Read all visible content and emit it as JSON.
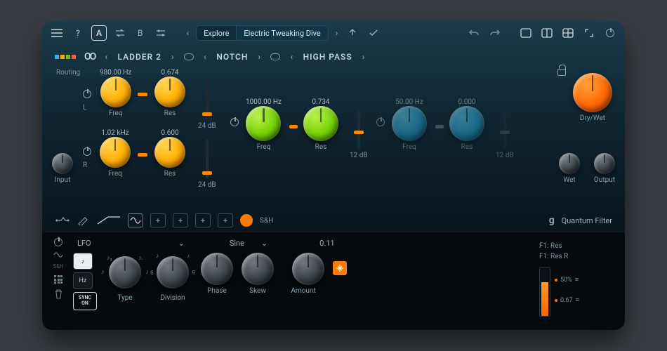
{
  "toolbar": {
    "ab_a": "A",
    "ab_b": "B",
    "explore": "Explore",
    "preset": "Electric Tweaking Dive"
  },
  "filters": {
    "routing_label": "Routing",
    "tab1": "LADDER 2",
    "tab2": "NOTCH",
    "tab3": "HIGH PASS"
  },
  "f1": {
    "freqL_val": "980.00 Hz",
    "resL_val": "0.674",
    "freqR_val": "1.02 kHz",
    "resR_val": "0.600",
    "slopeL": "24 dB",
    "slopeR": "24 dB",
    "chL": "L",
    "chR": "R",
    "freq_label": "Freq",
    "res_label": "Res"
  },
  "f2": {
    "freq_val": "1000.00 Hz",
    "res_val": "0.734",
    "slope": "12 dB",
    "freq_label": "Freq",
    "res_label": "Res"
  },
  "f3": {
    "freq_val": "50.00 Hz",
    "res_val": "0.000",
    "slope": "12 dB",
    "freq_label": "Freq",
    "res_label": "Res"
  },
  "io": {
    "input": "Input",
    "drywet": "Dry/Wet",
    "wet": "Wet",
    "output": "Output"
  },
  "mod": {
    "sh": "S&H"
  },
  "brand": "Quantum Filter",
  "lfo": {
    "title": "LFO",
    "hz": "Hz",
    "note": "♪",
    "sync1": "SYNC",
    "sync2": "ON",
    "wave": "Sine",
    "amount_val": "0.11",
    "type": "Type",
    "division": "Division",
    "phase": "Phase",
    "skew": "Skew",
    "amount": "Amount",
    "target1": "F1: Res",
    "target2": "F1: Res R",
    "m50": "50%",
    "m067": "0.67"
  }
}
